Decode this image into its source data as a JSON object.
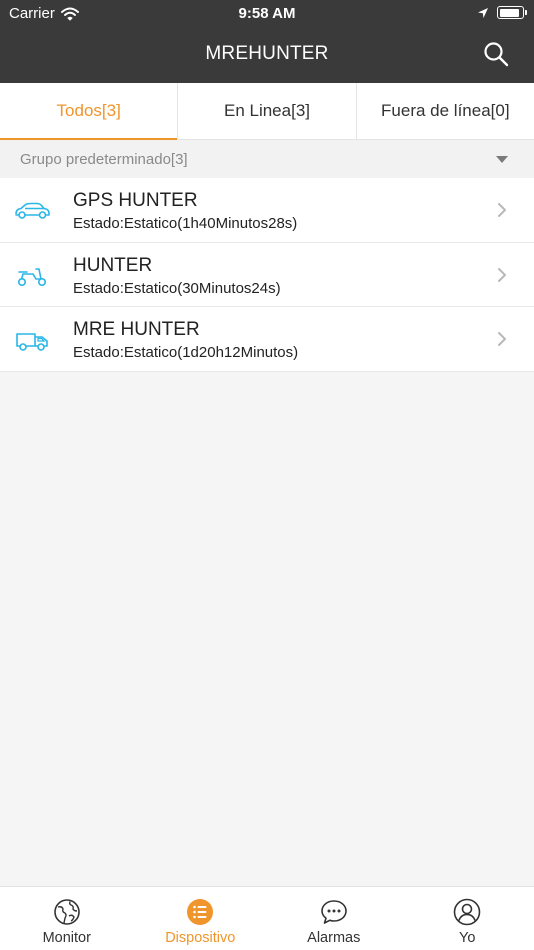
{
  "status_bar": {
    "carrier": "Carrier",
    "time": "9:58 AM"
  },
  "header": {
    "title": "MREHUNTER"
  },
  "tabs": [
    {
      "label": "Todos[3]",
      "active": true
    },
    {
      "label": "En Linea[3]",
      "active": false
    },
    {
      "label": "Fuera de línea[0]",
      "active": false
    }
  ],
  "group": {
    "label": "Grupo predeterminado[3]"
  },
  "devices": [
    {
      "name": "GPS HUNTER",
      "status": "Estado:Estatico(1h40Minutos28s)",
      "icon": "car-icon"
    },
    {
      "name": "HUNTER",
      "status": "Estado:Estatico(30Minutos24s)",
      "icon": "scooter-icon"
    },
    {
      "name": "MRE HUNTER",
      "status": "Estado:Estatico(1d20h12Minutos)",
      "icon": "truck-icon"
    }
  ],
  "tabbar": [
    {
      "label": "Monitor",
      "icon": "globe-icon",
      "active": false
    },
    {
      "label": "Dispositivo",
      "icon": "list-icon",
      "active": true
    },
    {
      "label": "Alarmas",
      "icon": "chat-bubble-icon",
      "active": false
    },
    {
      "label": "Yo",
      "icon": "user-icon",
      "active": false
    }
  ],
  "colors": {
    "accent": "#f0952c",
    "header_bg": "#3a3a3a",
    "vehicle_icon": "#29b6e8"
  },
  "battery_level": 0.95
}
